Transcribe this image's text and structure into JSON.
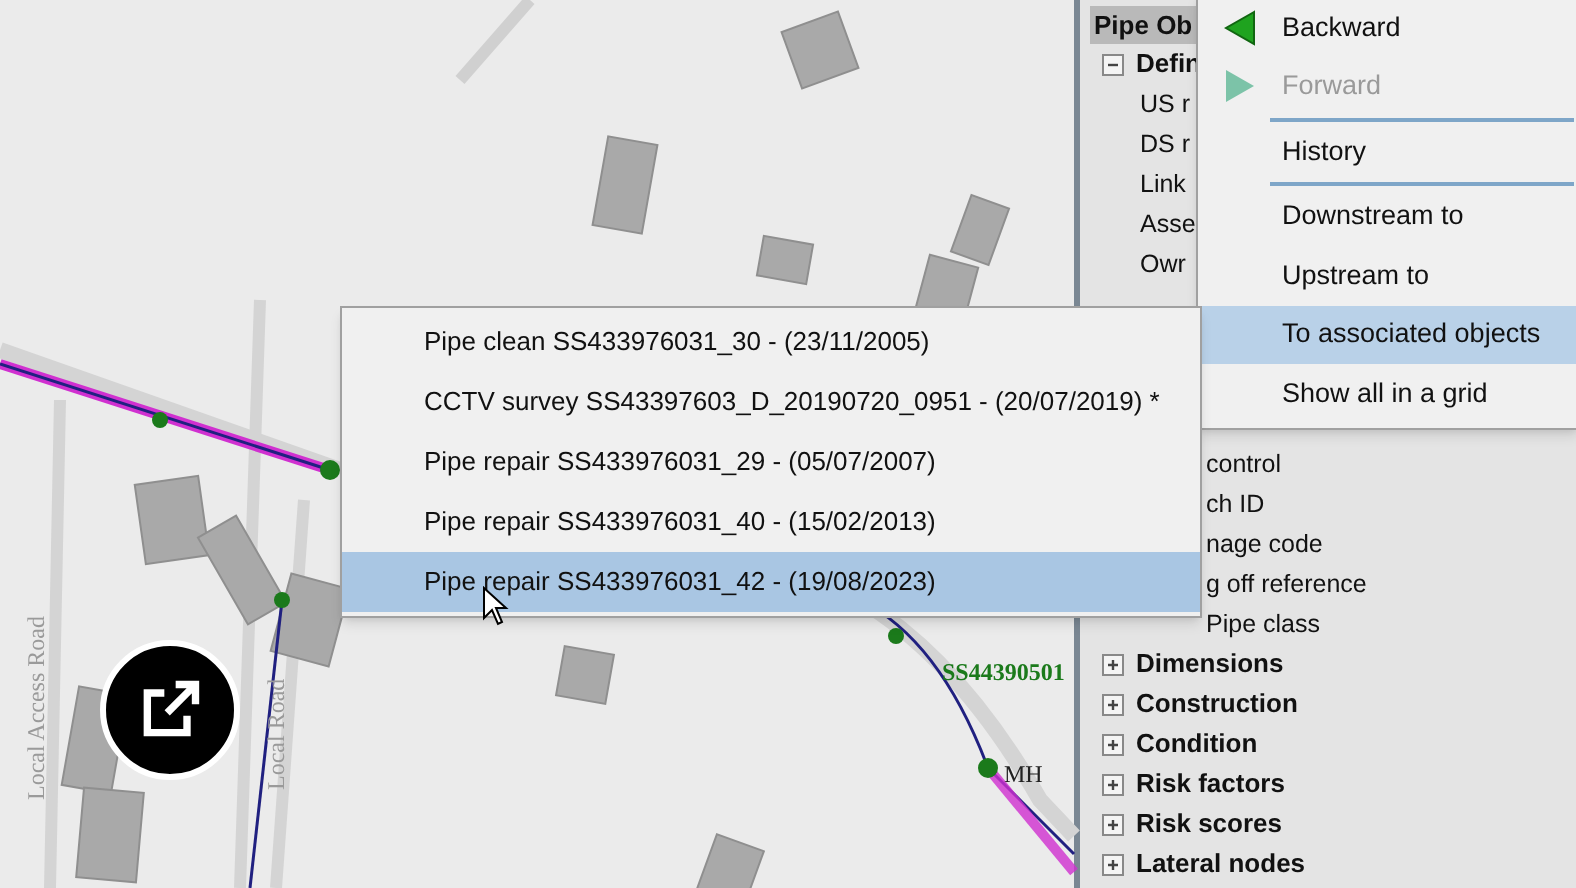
{
  "map": {
    "labels": [
      {
        "kind": "node",
        "text": "SS44390501"
      },
      {
        "kind": "node",
        "text": "MH"
      },
      {
        "kind": "road",
        "text": "Local Road"
      },
      {
        "kind": "road",
        "text": "Local Access Road"
      }
    ]
  },
  "property_panel": {
    "title": "Pipe Ob",
    "items": [
      {
        "label": "Defin",
        "expanded": true,
        "children": [
          {
            "label": "US r"
          },
          {
            "label": "DS r"
          },
          {
            "label": "Link"
          },
          {
            "label": "Asse"
          },
          {
            "label": "Owr"
          },
          {
            "label": "control"
          },
          {
            "label": "ch ID"
          },
          {
            "label": "nage code"
          },
          {
            "label": "g off reference"
          },
          {
            "label": "Pipe class"
          }
        ]
      },
      {
        "label": "Dimensions",
        "expanded": false
      },
      {
        "label": "Construction",
        "expanded": false
      },
      {
        "label": "Condition",
        "expanded": false
      },
      {
        "label": "Risk factors",
        "expanded": false
      },
      {
        "label": "Risk scores",
        "expanded": false
      },
      {
        "label": "Lateral nodes",
        "expanded": false
      }
    ]
  },
  "context_menu": {
    "items": [
      {
        "kind": "back",
        "label": "Backward",
        "disabled": false,
        "selected": false
      },
      {
        "kind": "forward",
        "label": "Forward",
        "disabled": true,
        "selected": false
      },
      {
        "kind": "separator"
      },
      {
        "kind": "item",
        "label": "History",
        "disabled": false,
        "selected": false
      },
      {
        "kind": "separator"
      },
      {
        "kind": "item",
        "label": "Downstream to",
        "disabled": false,
        "selected": false
      },
      {
        "kind": "item",
        "label": "Upstream to",
        "disabled": false,
        "selected": false
      },
      {
        "kind": "item",
        "label": "To associated objects",
        "disabled": false,
        "selected": true
      },
      {
        "kind": "item",
        "label": "Show all in a grid",
        "disabled": false,
        "selected": false
      }
    ]
  },
  "submenu": {
    "items": [
      {
        "label": "Pipe clean SS433976031_30 - (23/11/2005)",
        "selected": false
      },
      {
        "label": "CCTV survey SS43397603_D_20190720_0951 - (20/07/2019) *",
        "selected": false
      },
      {
        "label": "Pipe repair SS433976031_29 - (05/07/2007)",
        "selected": false
      },
      {
        "label": "Pipe repair SS433976031_40 - (15/02/2013)",
        "selected": false
      },
      {
        "label": "Pipe repair SS433976031_42 - (19/08/2023)",
        "selected": true
      }
    ]
  }
}
